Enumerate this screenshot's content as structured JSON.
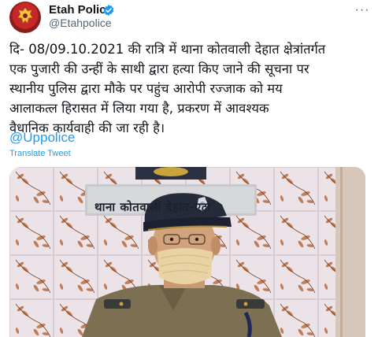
{
  "author": {
    "name": "Etah Police",
    "handle": "@Etahpolice",
    "verified": true
  },
  "tweet": {
    "text": "दि- 08/09.10.2021 की रात्रि में थाना कोतवाली देहात क्षेत्रांतर्गत\nएक पुजारी की उन्हीं के साथी द्वारा हत्या किए जाने की सूचना पर\nस्थानीय पुलिस द्वारा मौके पर पहुंच आरोपी रज्जाक को मय\nआलाकत्ल हिरासत में लिया गया है, प्रकरण में आवश्यक\nवैधानिक कार्यवाही की जा रही है।",
    "mention": "@Uppolice",
    "translate_label": "Translate Tweet"
  },
  "media": {
    "sign_text": "थाना कोतवाली देहात-एटा"
  },
  "menu": {
    "more_label": "···"
  },
  "colors": {
    "link": "#1d9bf0",
    "verified": "#1d9bf0",
    "secondary_text": "#536471"
  },
  "icons": {
    "verified": "verified-badge-icon",
    "more": "more-options-icon"
  }
}
